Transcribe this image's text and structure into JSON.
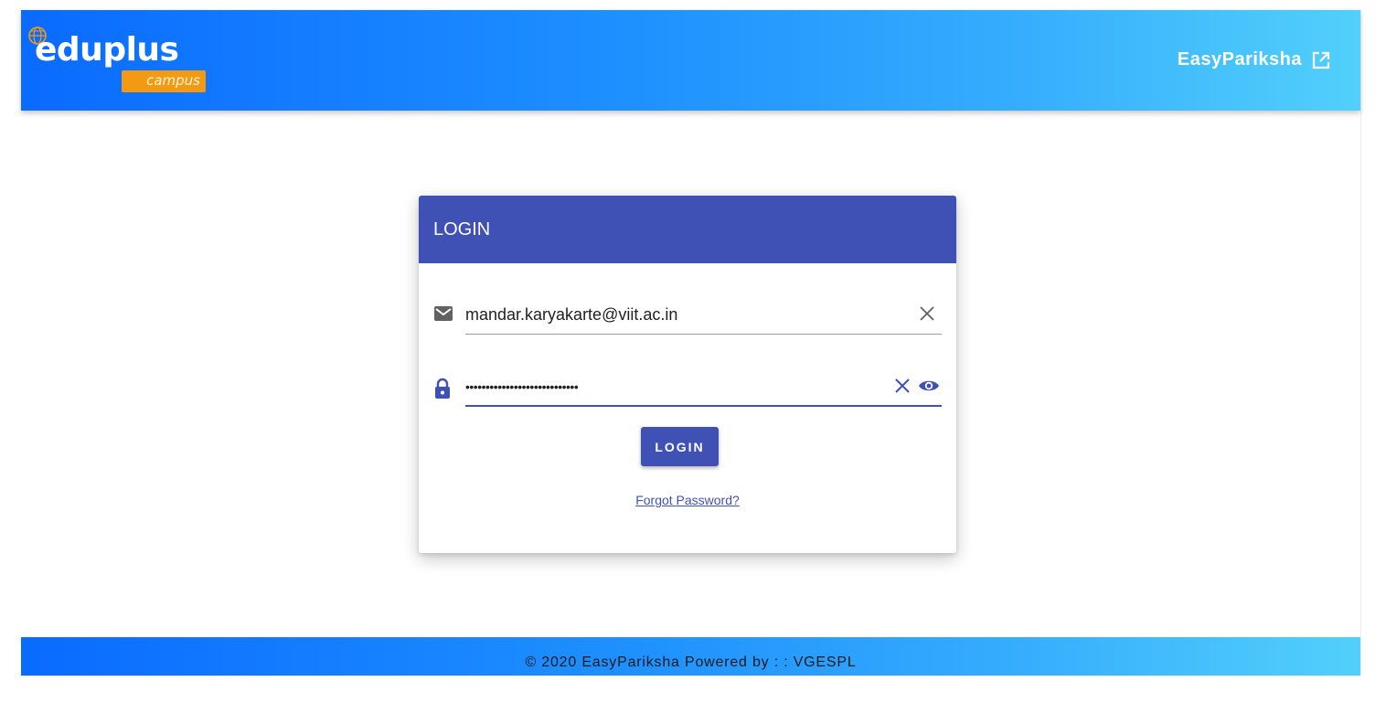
{
  "header": {
    "logo_main": "eduplus",
    "logo_sub": "campus",
    "external_link_label": "EasyPariksha"
  },
  "login_card": {
    "title": "LOGIN",
    "email": {
      "value": "mandar.karyakarte@viit.ac.in"
    },
    "password": {
      "value": "••••••••••••••••••••••••••••"
    },
    "submit_label": "LOGIN",
    "forgot_label": "Forgot Password?"
  },
  "footer": {
    "text": "© 2020 EasyPariksha Powered by : : VGESPL"
  },
  "icons": {
    "email": "envelope-icon",
    "password": "lock-icon",
    "clear": "close-icon",
    "reveal": "eye-icon",
    "external": "open-in-new-icon",
    "logo_globe": "globe-icon"
  },
  "colors": {
    "primary": "#3f51b5",
    "header_gradient_start": "#0a6bff",
    "header_gradient_end": "#52d0fb",
    "logo_accent": "#f39a12"
  }
}
